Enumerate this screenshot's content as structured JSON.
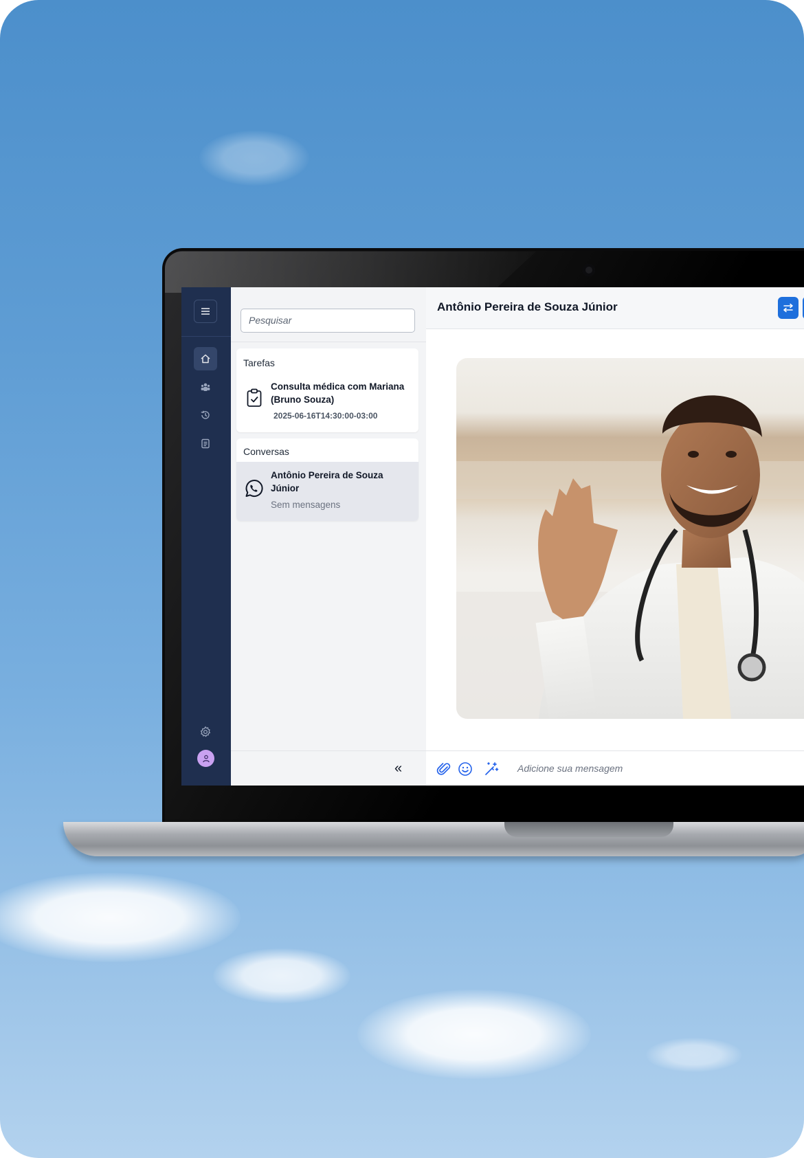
{
  "sidebar": {
    "nav": [
      {
        "icon": "home-icon",
        "active": true
      },
      {
        "icon": "users-icon",
        "active": false
      },
      {
        "icon": "history-icon",
        "active": false
      },
      {
        "icon": "clipboard-list-icon",
        "active": false
      }
    ],
    "bottom": [
      {
        "icon": "gear-icon"
      },
      {
        "icon": "user-avatar-icon"
      }
    ]
  },
  "panel": {
    "search_placeholder": "Pesquisar",
    "tasks": {
      "title": "Tarefas",
      "items": [
        {
          "title": "Consulta médica com Mariana (Bruno Souza)",
          "datetime": "2025-06-16T14:30:00-03:00",
          "icon": "clipboard-check-icon"
        }
      ]
    },
    "conversations": {
      "title": "Conversas",
      "items": [
        {
          "name": "Antônio Pereira de Souza Júnior",
          "preview": "Sem mensagens",
          "icon": "whatsapp-icon"
        }
      ]
    },
    "collapse_label": "«"
  },
  "chat": {
    "contact_name": "Antônio Pereira de Souza Júnior",
    "header_button_icon": "swap-arrows-icon",
    "composer_placeholder": "Adicione sua mensagem",
    "composer_icons": [
      "paperclip-icon",
      "emoji-icon",
      "magic-wand-icon"
    ]
  },
  "colors": {
    "rail": "#1f2f4f",
    "accent": "#1e6fdc"
  }
}
